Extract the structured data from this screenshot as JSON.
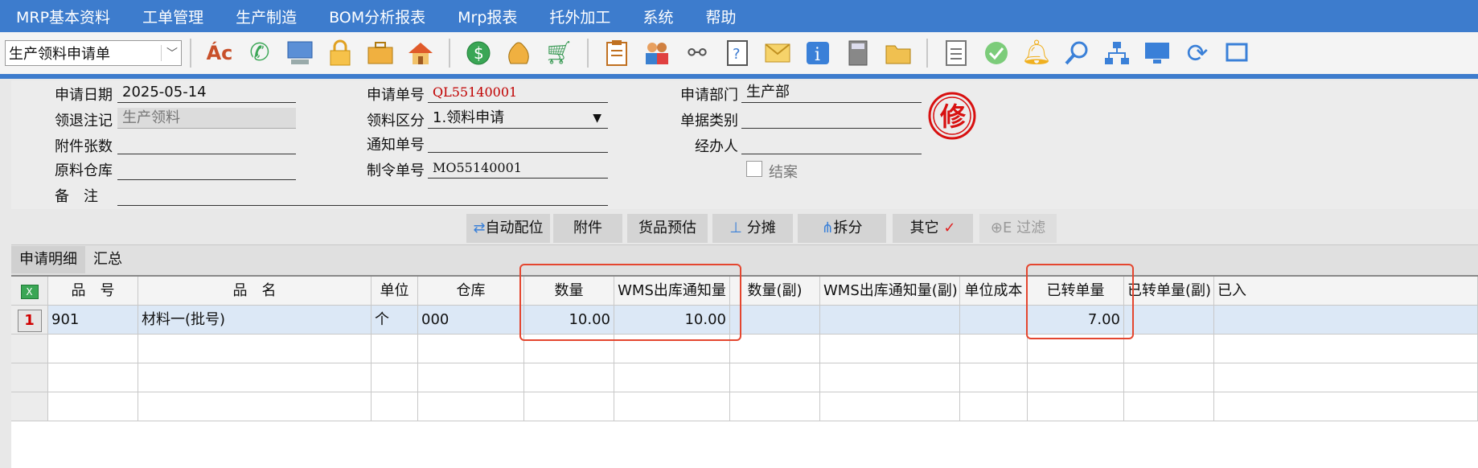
{
  "menu": [
    "MRP基本资料",
    "工单管理",
    "生产制造",
    "BOM分析报表",
    "Mrp报表",
    "托外加工",
    "系统",
    "帮助"
  ],
  "toolbar": {
    "doc_type": "生产领料申请单",
    "icons": [
      "abc-icon",
      "phone-icon",
      "computer-icon",
      "lock-icon",
      "briefcase-icon",
      "home-icon",
      "dollar-icon",
      "money-bag-icon",
      "cart-icon",
      "clipboard-icon",
      "users-icon",
      "link-icon",
      "help-doc-icon",
      "mail-icon",
      "info-icon",
      "calculator-icon",
      "folder-icon",
      "document-icon",
      "check-icon",
      "bell-icon",
      "search-icon",
      "org-chart-icon",
      "monitor-icon",
      "refresh-icon",
      "window-icon"
    ]
  },
  "form": {
    "apply_date_label": "申请日期",
    "apply_date": "2025-05-14",
    "return_mark_label": "领退注记",
    "return_mark": "生产领料",
    "attachments_label": "附件张数",
    "attachments": "",
    "warehouse_label": "原料仓库",
    "warehouse": "",
    "remark_label": "备　注",
    "remark": "",
    "apply_no_label": "申请单号",
    "apply_no": "QL55140001",
    "category_label": "领料区分",
    "category": "1.领料申请",
    "notice_no_label": "通知单号",
    "notice_no": "",
    "mo_no_label": "制令单号",
    "mo_no": "MO55140001",
    "dept_label": "申请部门",
    "dept": "生产部",
    "doc_kind_label": "单据类别",
    "doc_kind": "",
    "handler_label": "经办人",
    "handler": "",
    "close_label": "结案",
    "stamp_char": "修"
  },
  "actions": {
    "auto_locate": "自动配位",
    "attach": "附件",
    "goods_est": "货品预估",
    "allocate": "分摊",
    "split": "拆分",
    "other": "其它",
    "filter": "E 过滤"
  },
  "tabs": [
    "申请明细",
    "汇总"
  ],
  "grid": {
    "headers": [
      "品　号",
      "品　名",
      "单位",
      "仓库",
      "数量",
      "WMS出库通知量",
      "数量(副)",
      "WMS出库通知量(副)",
      "单位成本",
      "已转单量",
      "已转单量(副)",
      "已入"
    ],
    "rows": [
      {
        "no": "1",
        "item_no": "901",
        "item_name": "材料一(批号)",
        "unit": "个",
        "warehouse": "000",
        "qty": "10.00",
        "wms_qty": "10.00",
        "qty2": "",
        "wms_qty2": "",
        "unit_cost": "",
        "transferred": "7.00",
        "transferred2": "",
        "in": ""
      }
    ]
  },
  "colors": {
    "menu_bg": "#3d7ccd",
    "highlight": "#e4462f",
    "row_num": "#d00000"
  }
}
